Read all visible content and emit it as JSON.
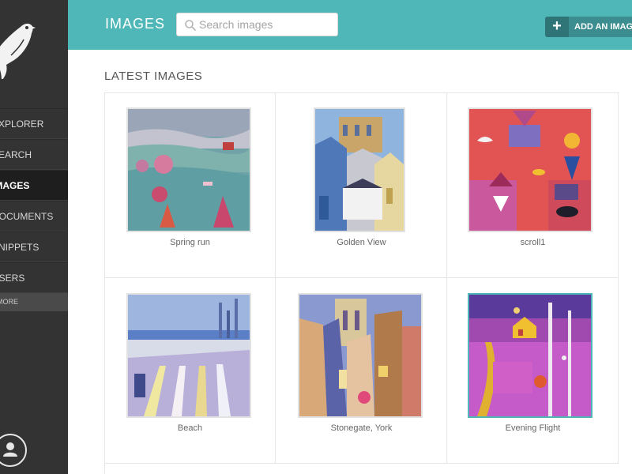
{
  "sidebar": {
    "items": [
      {
        "label": "Explorer",
        "active": false
      },
      {
        "label": "Search",
        "active": false
      },
      {
        "label": "Images",
        "active": true
      },
      {
        "label": "Documents",
        "active": false
      },
      {
        "label": "Snippets",
        "active": false
      },
      {
        "label": "Users",
        "active": false
      }
    ],
    "more_label": "More",
    "account_icon": "user-icon"
  },
  "header": {
    "title": "IMAGES",
    "search": {
      "placeholder": "Search images",
      "value": ""
    },
    "add_button": {
      "icon": "plus-icon",
      "label": "ADD AN IMAGE"
    }
  },
  "main": {
    "section_title": "LATEST IMAGES",
    "images": [
      {
        "title": "Spring run",
        "selected": false
      },
      {
        "title": "Golden View",
        "selected": false
      },
      {
        "title": "scroll1",
        "selected": false
      },
      {
        "title": "Beach",
        "selected": false
      },
      {
        "title": "Stonegate, York",
        "selected": false
      },
      {
        "title": "Evening Flight",
        "selected": true
      }
    ]
  },
  "colors": {
    "accent": "#4fb7b7",
    "sidebar": "#333333",
    "button": "#3b8d8f"
  }
}
